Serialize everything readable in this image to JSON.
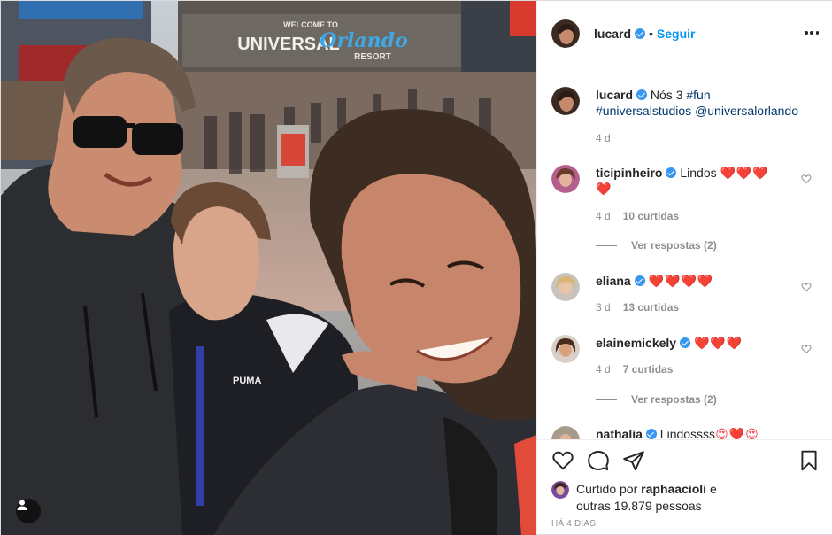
{
  "post": {
    "author": "lucard",
    "follow_label": "Seguir",
    "dot": "•",
    "photo_sign_line1": "WELCOME TO",
    "photo_sign_universal": "UNIVERSAL",
    "photo_sign_orlando": "Orlando",
    "photo_sign_resort": "RESORT",
    "photo_shirt_brand": "PUMA",
    "caption": {
      "username": "lucard",
      "text": "Nós 3",
      "tags": "#fun #universalstudios",
      "mention": "@universalorlando",
      "time": "4 d"
    }
  },
  "comments": [
    {
      "username": "ticipinheiro",
      "text": "Lindos",
      "hearts": "❤️❤️❤️",
      "hearts_line2": "❤️",
      "time": "4 d",
      "likes": "10 curtidas",
      "replies": "Ver respostas (2)"
    },
    {
      "username": "eliana",
      "text": "",
      "hearts": "❤️❤️❤️❤️",
      "time": "3 d",
      "likes": "13 curtidas"
    },
    {
      "username": "elainemickely",
      "text": "",
      "hearts": "❤️❤️❤️",
      "time": "4 d",
      "likes": "7 curtidas",
      "replies": "Ver respostas (2)"
    },
    {
      "username": "nathalia",
      "text": "Lindossss",
      "hearts": "😍❤️😍"
    }
  ],
  "footer": {
    "liked_by_prefix": "Curtido por",
    "liked_by_user": "raphaacioli",
    "liked_by_and": "e",
    "liked_by_rest": "outras 19.879 pessoas",
    "timestamp": "HÁ 4 DIAS"
  },
  "icons": {
    "like": "heart-outline-icon",
    "comment": "comment-icon",
    "share": "paper-plane-icon",
    "save": "bookmark-icon",
    "more": "more-options-icon",
    "tag": "user-tag-icon",
    "verified": "verified-badge-icon"
  },
  "colors": {
    "link_blue": "#0095f6",
    "verified_blue": "#3897f0",
    "heart_red": "#ed4956",
    "muted": "#8e8e8e"
  }
}
